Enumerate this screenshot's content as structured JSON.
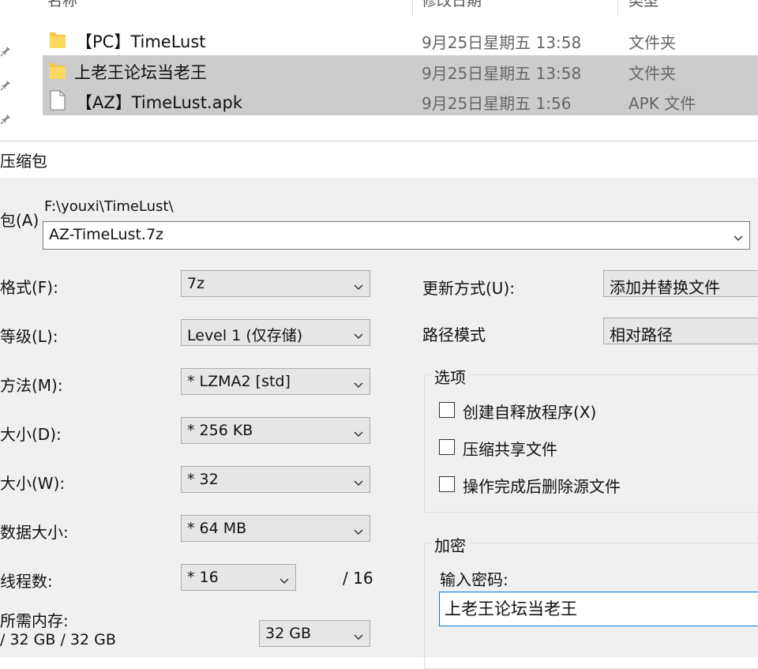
{
  "explorer": {
    "columns": {
      "name": "名称",
      "date": "修改日期",
      "type": "类型"
    },
    "files": [
      {
        "name": "【PC】TimeLust",
        "date": "9月25日星期五 13:58",
        "type": "文件夹",
        "kind": "folder",
        "selected": false
      },
      {
        "name": "上老王论坛当老王",
        "date": "9月25日星期五 13:58",
        "type": "文件夹",
        "kind": "folder",
        "selected": true
      },
      {
        "name": "【AZ】TimeLust.apk",
        "date": "9月25日星期五 1:56",
        "type": "APK 文件",
        "kind": "file",
        "selected": true
      }
    ]
  },
  "dialog": {
    "title": "压缩包",
    "archive_label": "包(A)",
    "archive_path": "F:\\youxi\\TimeLust\\",
    "archive_name": "AZ-TimeLust.7z",
    "rows": [
      {
        "label": "格式(F):",
        "value": "7z"
      },
      {
        "label": "等级(L):",
        "value": "Level 1 (仅存储)"
      },
      {
        "label": "方法(M):",
        "value": "*  LZMA2 [std]"
      },
      {
        "label": "大小(D):",
        "value": "*  256 KB"
      },
      {
        "label": "大小(W):",
        "value": "*  32"
      },
      {
        "label": "数据大小:",
        "value": "*  64 MB"
      },
      {
        "label": "线程数:",
        "value": "*  16"
      }
    ],
    "threads_total": "/ 16",
    "memory_label": "所需内存:",
    "memory_value": "/ 32 GB / 32 GB",
    "memory_select": "32 GB",
    "update_label": "更新方式(U):",
    "update_value": "添加并替换文件",
    "path_mode_label": "路径模式",
    "path_mode_value": "相对路径",
    "options": {
      "title": "选项",
      "items": [
        {
          "label": "创建自释放程序(X)",
          "checked": false
        },
        {
          "label": "压缩共享文件",
          "checked": false
        },
        {
          "label": "操作完成后删除源文件",
          "checked": false
        }
      ]
    },
    "encryption": {
      "title": "加密",
      "password_label": "输入密码:",
      "password_value": "上老王论坛当老王"
    }
  }
}
